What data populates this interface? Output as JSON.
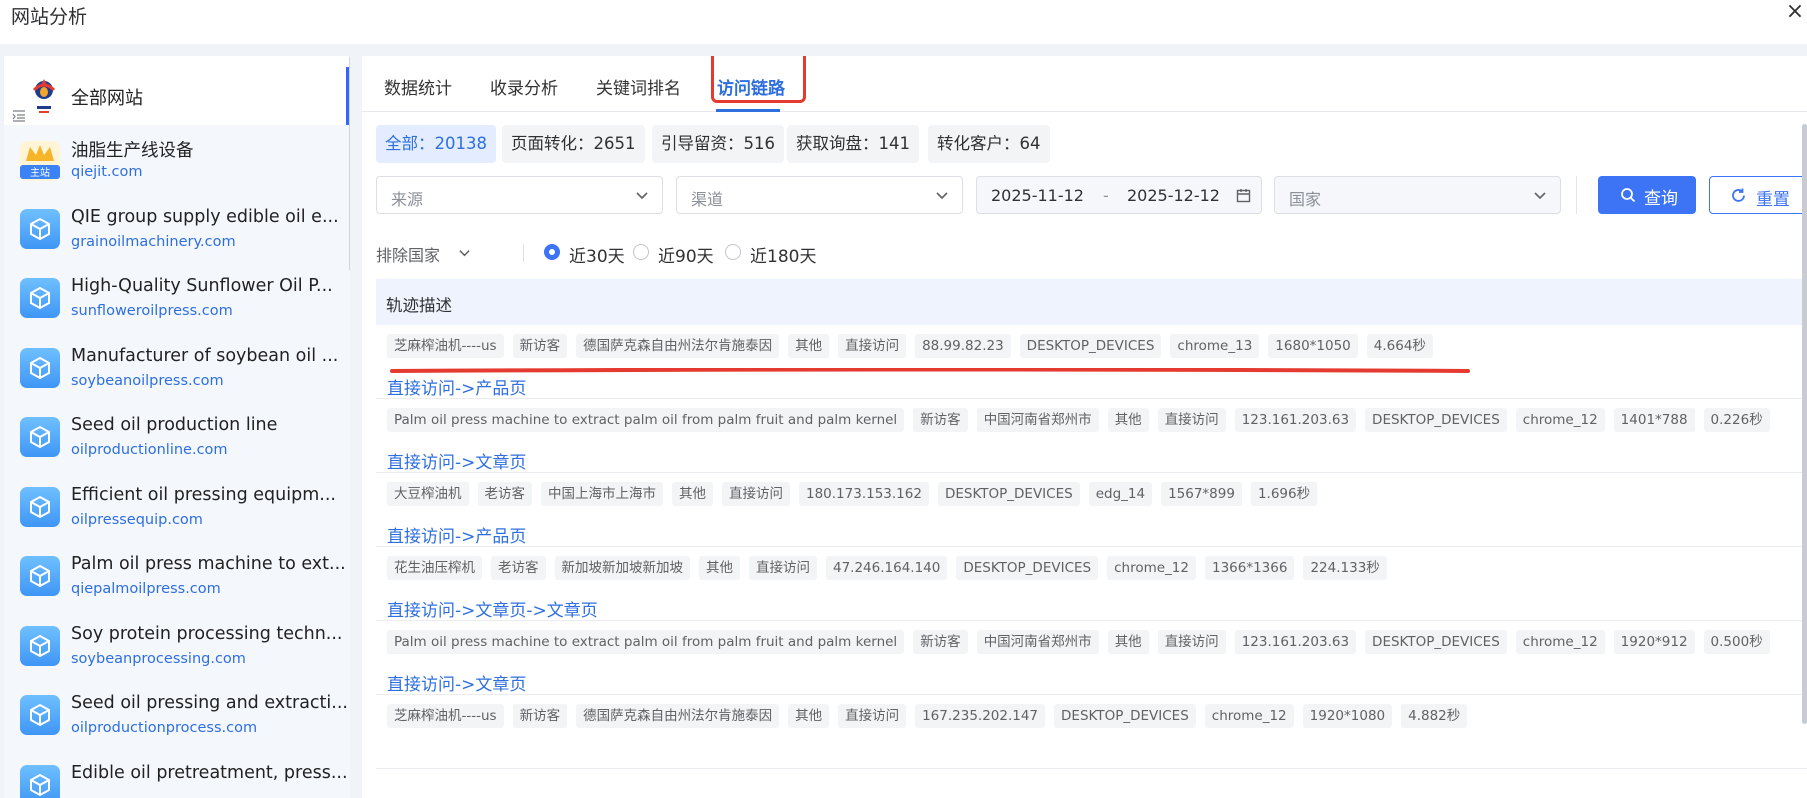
{
  "window": {
    "title": "网站分析",
    "close_glyph": "×"
  },
  "sidebar": {
    "all_sites_label": "全部网站",
    "main_badge": "主站",
    "items": [
      {
        "name": "油脂生产线设备",
        "domain": "qiejit.com"
      },
      {
        "name": "QIE group supply edible oil e...",
        "domain": "grainoilmachinery.com"
      },
      {
        "name": "High-Quality Sunflower Oil P...",
        "domain": "sunfloweroilpress.com"
      },
      {
        "name": "Manufacturer of soybean oil ...",
        "domain": "soybeanoilpress.com"
      },
      {
        "name": "Seed oil production line",
        "domain": "oilproductionline.com"
      },
      {
        "name": "Efficient oil pressing equipm...",
        "domain": "oilpressequip.com"
      },
      {
        "name": "Palm oil press machine to ext...",
        "domain": "qiepalmoilpress.com"
      },
      {
        "name": "Soy protein processing techn...",
        "domain": "soybeanprocessing.com"
      },
      {
        "name": "Seed oil pressing and extracti...",
        "domain": "oilproductionprocess.com"
      },
      {
        "name": "Edible oil pretreatment, press...",
        "domain": ""
      }
    ]
  },
  "tabs": [
    {
      "label": "数据统计"
    },
    {
      "label": "收录分析"
    },
    {
      "label": "关键词排名"
    },
    {
      "label": "访问链路"
    }
  ],
  "stats": [
    {
      "label": "全部：20138"
    },
    {
      "label": "页面转化：2651"
    },
    {
      "label": "引导留资：516"
    },
    {
      "label": "获取询盘：141"
    },
    {
      "label": "转化客户：64"
    }
  ],
  "filters": {
    "source_placeholder": "来源",
    "channel_placeholder": "渠道",
    "date_start": "2025-11-12",
    "date_sep": "-",
    "date_end": "2025-12-12",
    "country_placeholder": "国家",
    "query_label": "查询",
    "reset_label": "重置",
    "exclude_label": "排除国家",
    "ranges": [
      "近30天",
      "近90天",
      "近180天"
    ],
    "selected_range": "近30天"
  },
  "table": {
    "header": "轨迹描述",
    "rows": [
      {
        "tags": [
          "芝麻榨油机----us",
          "新访客",
          "德国萨克森自由州法尔肯施泰因",
          "其他",
          "直接访问",
          "88.99.82.23",
          "DESKTOP_DEVICES",
          "chrome_13",
          "1680*1050",
          "4.664秒"
        ],
        "path": "直接访问->产品页"
      },
      {
        "tags": [
          "Palm oil press machine to extract palm oil from palm fruit and palm kernel",
          "新访客",
          "中国河南省郑州市",
          "其他",
          "直接访问",
          "123.161.203.63",
          "DESKTOP_DEVICES",
          "chrome_12",
          "1401*788",
          "0.226秒"
        ],
        "path": "直接访问->文章页"
      },
      {
        "tags": [
          "大豆榨油机",
          "老访客",
          "中国上海市上海市",
          "其他",
          "直接访问",
          "180.173.153.162",
          "DESKTOP_DEVICES",
          "edg_14",
          "1567*899",
          "1.696秒"
        ],
        "path": "直接访问->产品页"
      },
      {
        "tags": [
          "花生油压榨机",
          "老访客",
          "新加坡新加坡新加坡",
          "其他",
          "直接访问",
          "47.246.164.140",
          "DESKTOP_DEVICES",
          "chrome_12",
          "1366*1366",
          "224.133秒"
        ],
        "path": "直接访问->文章页->文章页"
      },
      {
        "tags": [
          "Palm oil press machine to extract palm oil from palm fruit and palm kernel",
          "新访客",
          "中国河南省郑州市",
          "其他",
          "直接访问",
          "123.161.203.63",
          "DESKTOP_DEVICES",
          "chrome_12",
          "1920*912",
          "0.500秒"
        ],
        "path": "直接访问->文章页"
      },
      {
        "tags": [
          "芝麻榨油机----us",
          "新访客",
          "德国萨克森自由州法尔肯施泰因",
          "其他",
          "直接访问",
          "167.235.202.147",
          "DESKTOP_DEVICES",
          "chrome_12",
          "1920*1080",
          "4.882秒"
        ],
        "path": ""
      }
    ]
  },
  "colors": {
    "accent": "#2e6fe0",
    "annotation": "#e53a2f",
    "button": "#3d73f5"
  },
  "icons": {
    "close": "close-icon",
    "chevron": "chevron-down-icon",
    "calendar": "calendar-icon",
    "search": "search-icon",
    "refresh": "refresh-icon",
    "site": "cube-icon"
  }
}
